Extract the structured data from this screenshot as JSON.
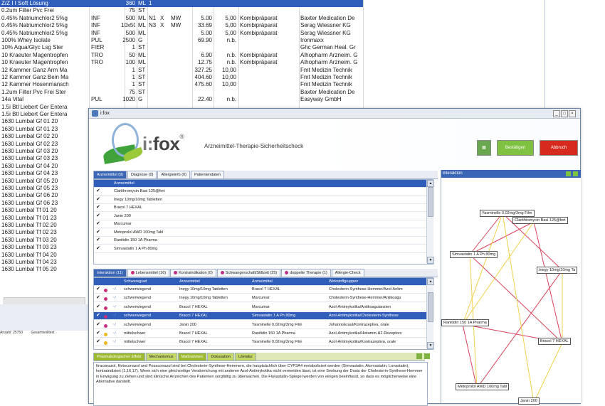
{
  "bg_table": {
    "rows": [
      {
        "name": "Z/Z I I Soft Lösung",
        "f": "",
        "q": "360",
        "u": "ML",
        "n": "1",
        "sel": true
      },
      {
        "name": "0.2um Filter Pvc Frei",
        "f": "",
        "q": "75",
        "u": "ST",
        "n": ""
      },
      {
        "name": "0.45% Natriumchlor2 5%g",
        "f": "INF",
        "q": "500",
        "u": "ML",
        "n": "N1",
        "x": "X",
        "k": "MW",
        "p": "5.00",
        "p2": "5,00",
        "kind": "Kombipräparat",
        "maker": "Baxter Medication De"
      },
      {
        "name": "0.45% Natriumchlor2 5%g",
        "f": "INF",
        "q": "10x500",
        "u": "ML",
        "n": "N3",
        "x": "X",
        "k": "MW",
        "p": "33.69",
        "p2": "5,00",
        "kind": "Kombipräparat",
        "maker": "Serag Wiessner KG"
      },
      {
        "name": "0.45% Natriumchlor2 5%g",
        "f": "INF",
        "q": "500",
        "u": "ML",
        "n": "",
        "p": "5.00",
        "p2": "5,00",
        "kind": "Kombipräparat",
        "maker": "Serag Wiessner KG"
      },
      {
        "name": "100% Whey Isolate",
        "f": "PUL",
        "q": "2500",
        "u": "G",
        "n": "",
        "p": "69.90",
        "p2": "n.b.",
        "maker": "Ironmaxx"
      },
      {
        "name": "10% Aqua/Glyc Lsg Ster",
        "f": "FIER",
        "q": "1",
        "u": "ST",
        "n": "",
        "maker": "Ghc German Heal. Gr"
      },
      {
        "name": "10 Kraeuter Magentropfen",
        "f": "TRO",
        "q": "50",
        "u": "ML",
        "n": "",
        "p": "6.90",
        "p2": "n.b.",
        "kind": "Kombipräparat",
        "maker": "Alhopharm Arzneim. G"
      },
      {
        "name": "10 Kraeuter Magentropfen",
        "f": "TRO",
        "q": "100",
        "u": "ML",
        "n": "",
        "p": "12.75",
        "p2": "n.b.",
        "kind": "Kombipräparat",
        "maker": "Alhopharm Arzneim. G"
      },
      {
        "name": "12 Kammer Ganz Arm Ma",
        "f": "",
        "q": "1",
        "u": "ST",
        "n": "",
        "p": "327.25",
        "p2": "10,00",
        "maker": "Fmt Medizin Technik"
      },
      {
        "name": "12 Kammer Ganz Bein Ma",
        "f": "",
        "q": "1",
        "u": "ST",
        "n": "",
        "p": "404.60",
        "p2": "10,00",
        "maker": "Fmt Medizin Technik"
      },
      {
        "name": "12 Kammer Hosenmansch",
        "f": "",
        "q": "1",
        "u": "ST",
        "n": "",
        "p": "475.60",
        "p2": "10,00",
        "maker": "Fmt Medizin Technik"
      },
      {
        "name": "1.2um Filter Pvc Frei Ster",
        "f": "",
        "q": "75",
        "u": "ST",
        "n": "",
        "maker": "Baxter Medication De"
      },
      {
        "name": "14a Vital",
        "f": "PUL",
        "q": "1020",
        "u": "G",
        "n": "",
        "p": "22.40",
        "p2": "n.b.",
        "maker": "Easyway GmbH"
      },
      {
        "name": "1.5i Btl Liebert Ger Entera",
        "f": "",
        "q": "",
        "u": "",
        "n": ""
      },
      {
        "name": "1.5i Btl Liebert Ger Entera",
        "f": "",
        "q": "",
        "u": "",
        "n": ""
      },
      {
        "name": "1630 Lumbal Gf 01 20"
      },
      {
        "name": "1630 Lumbal Gf 01 23"
      },
      {
        "name": "1630 Lumbal Gf 02 20"
      },
      {
        "name": "1630 Lumbal Gf 02 23"
      },
      {
        "name": "1630 Lumbal Gf 03 20"
      },
      {
        "name": "1630 Lumbal Gf 03 23"
      },
      {
        "name": "1630 Lumbal Gf 04 20"
      },
      {
        "name": "1630 Lumbal Gf 04 23"
      },
      {
        "name": "1630 Lumbal Gf 05 20"
      },
      {
        "name": "1630 Lumbal Gf 05 23"
      },
      {
        "name": "1630 Lumbal Gf 06 20"
      },
      {
        "name": "1630 Lumbal Gf 06 23"
      },
      {
        "name": "1630 Lumbal Tf 01 20"
      },
      {
        "name": "1630 Lumbal Tf 01 23"
      },
      {
        "name": "1630 Lumbal Tf 02 20"
      },
      {
        "name": "1630 Lumbal Tf 02 23"
      },
      {
        "name": "1630 Lumbal Tf 03 20"
      },
      {
        "name": "1630 Lumbal Tf 03 23"
      },
      {
        "name": "1630 Lumbal Tf 04 20"
      },
      {
        "name": "1630 Lumbal Tf 04 23"
      },
      {
        "name": "1630 Lumbal Tf 05 20"
      }
    ],
    "status": [
      "Anzahl: 25750",
      "Gesamtvolltext"
    ]
  },
  "window": {
    "title": "i:fox",
    "min": "_",
    "max": "□",
    "close": "×"
  },
  "banner": {
    "logo_prefix": "i:",
    "logo_main": "fox",
    "logo_reg": "®",
    "tagline": "Arzneimittel-Therapie-Sicherheitscheck",
    "btn_green_label": "Bestätigen",
    "btn_red_label": "Abbruch"
  },
  "med_tabs": [
    "Arzneimittel (9)",
    "Diagnose (0)",
    "Allergieinfo (0)",
    "Patientendaten"
  ],
  "med_header": "Arzneimittel",
  "medications": [
    {
      "name": "Clarithromycin Basi 125@fert",
      "checked": "✔"
    },
    {
      "name": "Inegy 10mg/10mg Tabletten",
      "checked": "✔"
    },
    {
      "name": "Bracol 7 HEXAL",
      "checked": "✔"
    },
    {
      "name": "Janin 200",
      "checked": "✔"
    },
    {
      "name": "Marcumar",
      "checked": "✔"
    },
    {
      "name": "Metoprolol AWD 100mg Tabl",
      "checked": "✔"
    },
    {
      "name": "Ranitidin 150 1A Pharma",
      "checked": "✔"
    },
    {
      "name": "Simvastatin 1 A Ph 80mg",
      "checked": "✔"
    }
  ],
  "int_tabs": [
    "Interaktion (11)",
    "Lebensmittel (16)",
    "Kontraindikation (0)",
    "Schwangerschaft/Stillzeit (25)",
    "doppelte Therapie (1)",
    "Allergie-Check"
  ],
  "int_headers": [
    "Schweregrad",
    "Arzneimittel",
    "Arzneimittel",
    "Wirkstoffgruppen"
  ],
  "interactions": [
    {
      "color": "#c8307e",
      "sev": "schwerwiegend",
      "a": "Inegy 10mg/10mg Tabletten",
      "b": "Bracol 7 HEXAL",
      "grp": "Cholesterin-Synthese-Hemmer/Azol-Antim"
    },
    {
      "color": "#c8307e",
      "sev": "schwerwiegend",
      "a": "Inegy 10mg/10mg Tabletten",
      "b": "Marcumar",
      "grp": "Cholesterin-Synthese-Hemmer/Antikoagu"
    },
    {
      "color": "#c8307e",
      "sev": "schwerwiegend",
      "a": "Bracol 7 HEXAL",
      "b": "Marcumar",
      "grp": "Azol-Antimykotika/Antikoagulanzien"
    },
    {
      "color": "#c8307e",
      "sev": "schwerwiegend",
      "a": "Bracol 7 HEXAL",
      "b": "Simvastatin 1 A Ph 80mg",
      "grp": "Azol-Antimykotika/Cholesterin-Synthese",
      "sel": true
    },
    {
      "color": "#c8307e",
      "sev": "schwerwiegend",
      "a": "Janin 200",
      "b": "Yasminelle 0.02mg/3mg Film",
      "grp": "Johanniskraut/Kontrazeptiva, orale"
    },
    {
      "color": "#e9b919",
      "sev": "mittelschwer",
      "a": "Bracol 7 HEXAL",
      "b": "Ranitidin 150 1A Pharma",
      "grp": "Azol-Antimykotika/Histamin-H2-Rezeptors"
    },
    {
      "color": "#e9b919",
      "sev": "mittelschwer",
      "a": "Bracol 7 HEXAL",
      "b": "Yasminelle 0.02mg/3mg Film",
      "grp": "Azol-Antimykotika/Kontrazeptiva, orale"
    }
  ],
  "info_tabs": [
    "Pharmakologischer Effekt",
    "Mechanismus",
    "Maßnahmen",
    "Dokusation",
    "Literatur"
  ],
  "info_text": "Itraconazol, Ketoconazol und Posaconazol sind bei Cholesterin-Synthese-Hemmern, die hauptsächlich über CYP3A4 metabolisiert werden (Simvastatin, Atorvastatin, Lovastatin), kontraindiziert (1,16,17). Wenn sich eine gleichzeitige Verabreichung mit anderen Azol-Antimykotika nicht vermeiden lässt, ist eine Senkung der Dosis der Cholesterin-Synthese-Hemmer in Erwägung zu ziehen und sind klinische Anzeichen des Patienten sorgfältig zu überwachen. Die Fluvastatin-Spiegel werden von einigen beeinflusst, so dass es möglicherweise eine Alternative darstellt.",
  "graph": {
    "title": "Interaktion",
    "nodes": [
      "Yasminelle 0.02mg/3mg Film",
      "Clarithromycin Basi 125@fert",
      "Simvastatin 1 A Ph 80mg",
      "Inegy 10mg/10mg Ta",
      "Ranitidin 150 1A Pharma",
      "Bracol 7 HEXAL",
      "Metoprolol AWD 100mg Tabl",
      "Janin 200"
    ]
  }
}
